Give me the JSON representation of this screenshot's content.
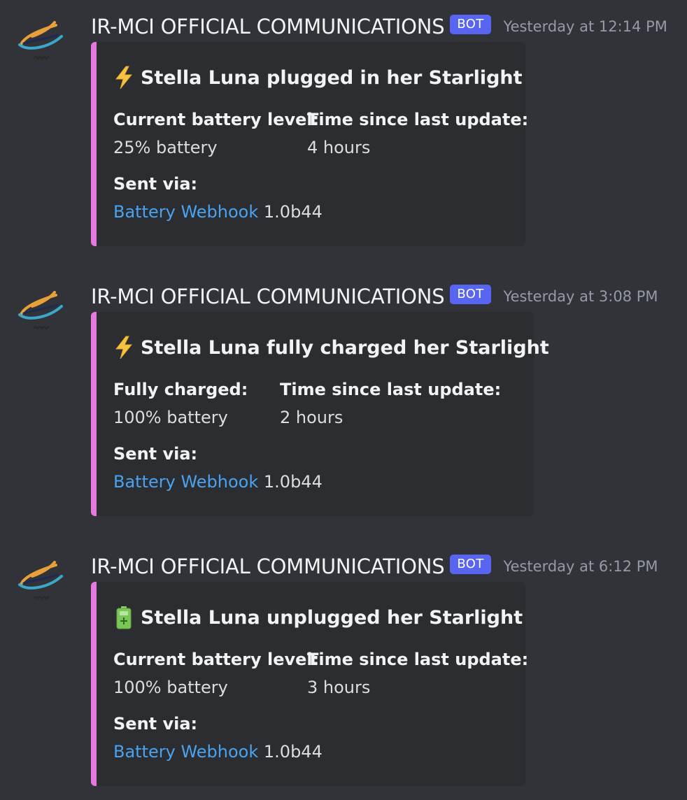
{
  "messages": [
    {
      "author": "IR-MCI OFFICIAL COMMUNICATIONS",
      "bot_tag": "BOT",
      "timestamp": "Yesterday at 12:14 PM",
      "embed": {
        "icon": "lightning-bolt-icon",
        "title": "Stella Luna plugged in her Starlight",
        "fields": [
          {
            "name": "Current battery level:",
            "value": "25% battery"
          },
          {
            "name": "Time since last update:",
            "value": "4 hours"
          }
        ],
        "sent_via_label": "Sent via:",
        "sent_via_link": "Battery Webhook",
        "sent_via_version": " 1.0b44"
      }
    },
    {
      "author": "IR-MCI OFFICIAL COMMUNICATIONS",
      "bot_tag": "BOT",
      "timestamp": "Yesterday at 3:08 PM",
      "embed": {
        "icon": "lightning-bolt-icon",
        "title": "Stella Luna fully charged her Starlight",
        "fields": [
          {
            "name": "Fully charged:",
            "value": "100% battery"
          },
          {
            "name": "Time since last update:",
            "value": "2 hours"
          }
        ],
        "sent_via_label": "Sent via:",
        "sent_via_link": "Battery Webhook",
        "sent_via_version": " 1.0b44"
      }
    },
    {
      "author": "IR-MCI OFFICIAL COMMUNICATIONS",
      "bot_tag": "BOT",
      "timestamp": "Yesterday at 6:12 PM",
      "embed": {
        "icon": "battery-icon",
        "title": "Stella Luna unplugged her Starlight",
        "fields": [
          {
            "name": "Current battery level:",
            "value": "100% battery"
          },
          {
            "name": "Time since last update:",
            "value": "3 hours"
          }
        ],
        "sent_via_label": "Sent via:",
        "sent_via_link": "Battery Webhook",
        "sent_via_version": " 1.0b44"
      }
    }
  ],
  "colors": {
    "background": "#313338",
    "embed_background": "#2b2d31",
    "embed_accent": "#e579dd",
    "bot_tag": "#5865f2",
    "link": "#4aa3f0",
    "timestamp": "#949ba4"
  }
}
